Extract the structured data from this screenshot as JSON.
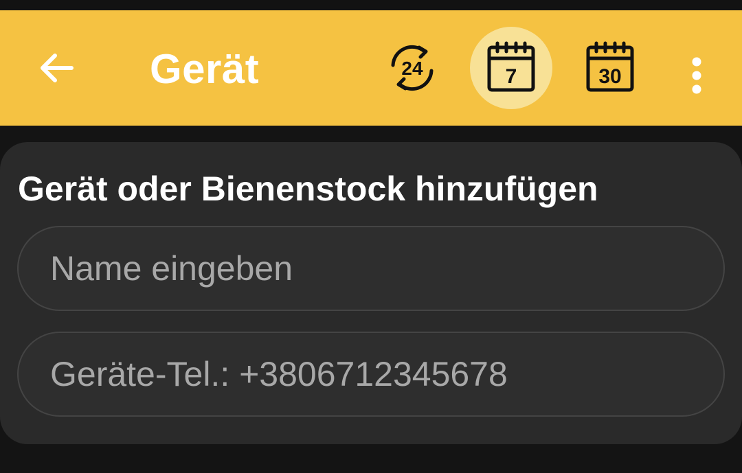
{
  "app_bar": {
    "title": "Gerät",
    "background": "#F5C242",
    "selected_background": "#F8E196",
    "actions": [
      {
        "id": "24h",
        "label": "24",
        "icon": "refresh-24h-icon",
        "selected": false
      },
      {
        "id": "7d",
        "label": "7",
        "icon": "calendar-7-icon",
        "selected": true
      },
      {
        "id": "30d",
        "label": "30",
        "icon": "calendar-30-icon",
        "selected": false
      }
    ]
  },
  "card": {
    "title": "Gerät oder Bienenstock hinzufügen",
    "name_field": {
      "placeholder": "Name eingeben",
      "value": ""
    },
    "phone_field": {
      "placeholder": "Geräte-Tel.: +3806712345678",
      "value": ""
    }
  }
}
